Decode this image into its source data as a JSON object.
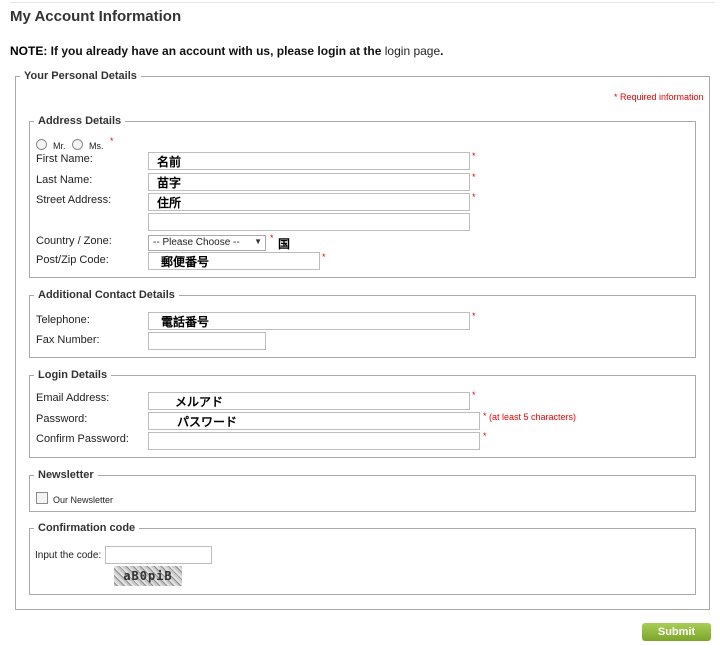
{
  "page": {
    "title": "My Account Information",
    "note_label": "NOTE:",
    "note_text": " If you already have an account with us, please login at the ",
    "note_link": "login page",
    "note_end": "."
  },
  "personal": {
    "legend": "Your Personal Details",
    "required_note": "* Required information"
  },
  "address": {
    "legend": "Address Details",
    "salutation_mr": "Mr.",
    "salutation_ms": "Ms.",
    "first_name_label": "First Name:",
    "first_name_value": "名前",
    "last_name_label": "Last Name:",
    "last_name_value": "苗字",
    "street_label": "Street Address:",
    "street_value": "住所",
    "street2_value": "",
    "country_label": "Country / Zone:",
    "country_selected": "-- Please Choose --",
    "country_note": "国",
    "postcode_label": "Post/Zip Code:",
    "postcode_value": "郵便番号"
  },
  "contact": {
    "legend": "Additional Contact Details",
    "telephone_label": "Telephone:",
    "telephone_value": "電話番号",
    "fax_label": "Fax Number:",
    "fax_value": ""
  },
  "login": {
    "legend": "Login Details",
    "email_label": "Email Address:",
    "email_value": "メルアド",
    "password_label": "Password:",
    "password_value": "パスワード",
    "password_hint": "(at least 5 characters)",
    "confirm_label": "Confirm Password:",
    "confirm_value": ""
  },
  "newsletter": {
    "legend": "Newsletter",
    "checkbox_label": "Our Newsletter"
  },
  "confirmation": {
    "legend": "Confirmation code",
    "input_label": "Input the code:",
    "input_value": "",
    "captcha_text": "aB0piB"
  },
  "submit_label": "Submit",
  "required_star": "*",
  "colors": {
    "required": "#e00000",
    "submit": "#8cb63a",
    "border": "#a9a9a9"
  }
}
